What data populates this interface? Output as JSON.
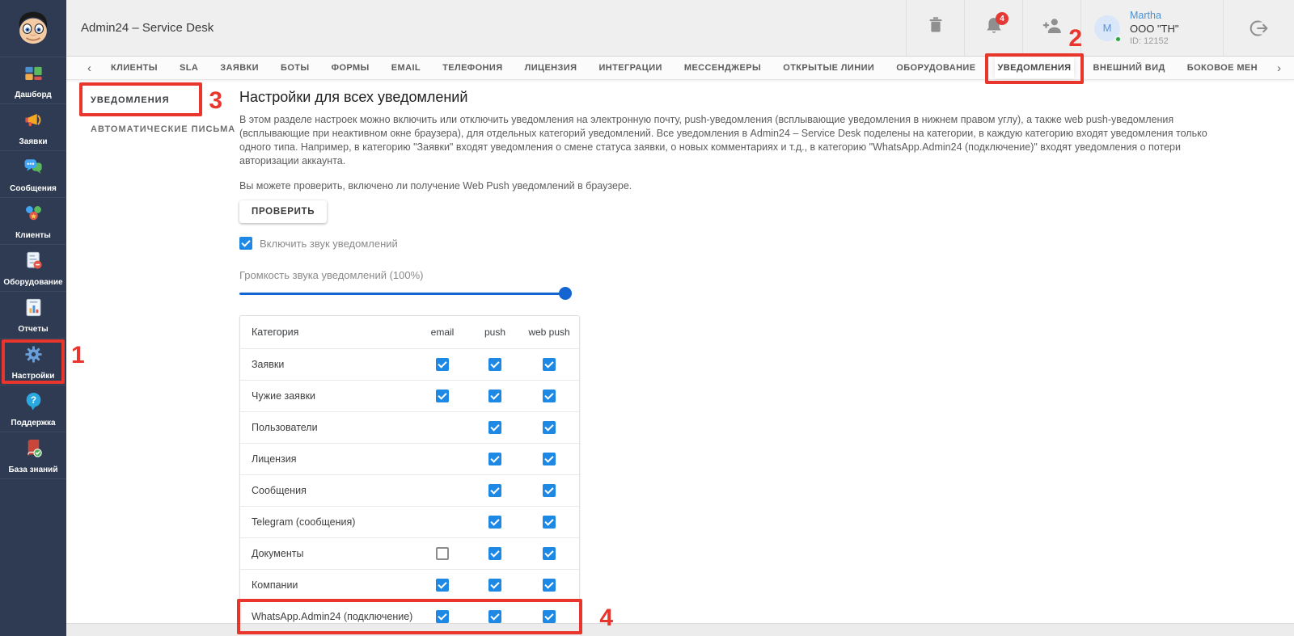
{
  "app": {
    "title": "Admin24 – Service Desk"
  },
  "header": {
    "actions": [
      {
        "icon": "trash-icon"
      },
      {
        "icon": "bell-icon",
        "badge": "4"
      },
      {
        "icon": "person-add-icon"
      }
    ],
    "logout_icon": "logout-icon",
    "user": {
      "initial": "M",
      "name": "Martha",
      "company": "ООО \"ТН\"",
      "id": "ID: 12152",
      "status": "online"
    }
  },
  "tabs": {
    "back": "‹",
    "forward": "›",
    "items": [
      "КЛИЕНТЫ",
      "SLA",
      "ЗАЯВКИ",
      "БОТЫ",
      "ФОРМЫ",
      "EMAIL",
      "ТЕЛЕФОНИЯ",
      "ЛИЦЕНЗИЯ",
      "ИНТЕГРАЦИИ",
      "МЕССЕНДЖЕРЫ",
      "ОТКРЫТЫЕ ЛИНИИ",
      "ОБОРУДОВАНИЕ",
      "УВЕДОМЛЕНИЯ",
      "ВНЕШНИЙ ВИД",
      "БОКОВОЕ МЕН"
    ],
    "active": "УВЕДОМЛЕНИЯ",
    "active_annotation": "2"
  },
  "sidebar": {
    "items": [
      {
        "key": "dashboard",
        "label": "Дашборд",
        "icon": "dashboard-icon"
      },
      {
        "key": "tickets",
        "label": "Заявки",
        "icon": "megaphone-icon"
      },
      {
        "key": "messages",
        "label": "Сообщения",
        "icon": "chat-icon"
      },
      {
        "key": "clients",
        "label": "Клиенты",
        "icon": "clients-icon"
      },
      {
        "key": "equipment",
        "label": "Оборудование",
        "icon": "equipment-icon"
      },
      {
        "key": "reports",
        "label": "Отчеты",
        "icon": "reports-icon"
      },
      {
        "key": "settings",
        "label": "Настройки",
        "icon": "gear-icon",
        "active": true,
        "annotation": "1"
      },
      {
        "key": "support",
        "label": "Поддержка",
        "icon": "help-icon"
      },
      {
        "key": "knowledge",
        "label": "База знаний",
        "icon": "book-icon"
      }
    ]
  },
  "submenu": {
    "items": [
      {
        "label": "УВЕДОМЛЕНИЯ",
        "active": true,
        "annotation": "3"
      },
      {
        "label": "АВТОМАТИЧЕСКИЕ ПИСЬМА",
        "active": false
      }
    ]
  },
  "main": {
    "title": "Настройки для всех уведомлений",
    "description": "В этом разделе настроек можно включить или отключить уведомления на электронную почту, push-уведомления (всплывающие уведомления в нижнем правом углу), а также web push-уведомления (всплывающие при неактивном окне браузера), для отдельных категорий уведомлений. Все уведомления в Admin24 – Service Desk поделены на категории, в каждую категорию входят уведомления только одного типа. Например, в категорию \"Заявки\" входят уведомления о смене статуса заявки, о новых комментариях и т.д., в категорию \"WhatsApp.Admin24 (подключение)\" входят уведомления о потери авторизации аккаунта.",
    "hint": "Вы можете проверить, включено ли получение Web Push уведомлений в браузере.",
    "button_label": "ПРОВЕРИТЬ",
    "sound_label": "Включить звук уведомлений",
    "sound_checked": true,
    "volume_label": "Громкость звука уведомлений (100%)",
    "volume_percent": 100,
    "table": {
      "headers": [
        "Категория",
        "email",
        "push",
        "web push"
      ],
      "rows": [
        {
          "category": "Заявки",
          "email": "checked",
          "push": "checked",
          "web_push": "checked"
        },
        {
          "category": "Чужие заявки",
          "email": "checked",
          "push": "checked",
          "web_push": "checked"
        },
        {
          "category": "Пользователи",
          "email": "none",
          "push": "checked",
          "web_push": "checked"
        },
        {
          "category": "Лицензия",
          "email": "none",
          "push": "checked",
          "web_push": "checked"
        },
        {
          "category": "Сообщения",
          "email": "none",
          "push": "checked",
          "web_push": "checked"
        },
        {
          "category": "Telegram (сообщения)",
          "email": "none",
          "push": "checked",
          "web_push": "checked"
        },
        {
          "category": "Документы",
          "email": "unchecked",
          "push": "checked",
          "web_push": "checked"
        },
        {
          "category": "Компании",
          "email": "checked",
          "push": "checked",
          "web_push": "checked"
        },
        {
          "category": "WhatsApp.Admin24 (подключение)",
          "email": "checked",
          "push": "checked",
          "web_push": "checked",
          "annotation": "4"
        }
      ]
    }
  },
  "colors": {
    "sidebar_bg": "#2e3b52",
    "header_bg": "#f0efef",
    "accent_blue": "#1e88e5",
    "slider_blue": "#1464d2",
    "annotation_red": "#e8362d",
    "badge_red": "#e53935",
    "online_green": "#27a844"
  }
}
